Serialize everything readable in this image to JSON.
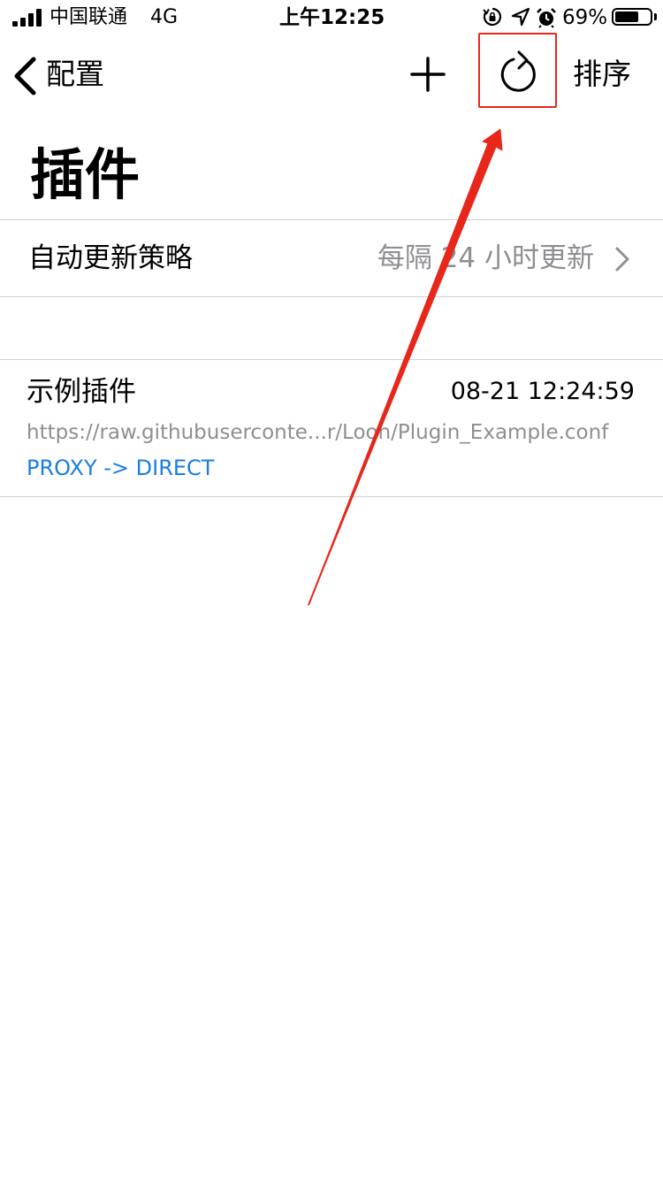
{
  "status_bar": {
    "carrier": "中国联通",
    "network": "4G",
    "time": "上午12:25",
    "battery_percent": "69%",
    "battery_level": 0.69,
    "icons": [
      "signal-icon",
      "orientation-lock-icon",
      "location-icon",
      "alarm-icon",
      "battery-icon"
    ]
  },
  "nav": {
    "back_label": "配置",
    "add_icon": "plus-icon",
    "refresh_icon": "refresh-icon",
    "sort_label": "排序"
  },
  "page": {
    "title": "插件"
  },
  "auto_update": {
    "label": "自动更新策略",
    "value": "每隔 24 小时更新"
  },
  "plugins": [
    {
      "name": "示例插件",
      "updated": "08-21 12:24:59",
      "url": "https://raw.githubuserconte...r/Loon/Plugin_Example.conf",
      "policy": "PROXY -> DIRECT"
    }
  ],
  "colors": {
    "accent_blue": "#1a7ee0",
    "secondary_gray": "#8e8e93",
    "annotation_red": "#e8271b"
  }
}
